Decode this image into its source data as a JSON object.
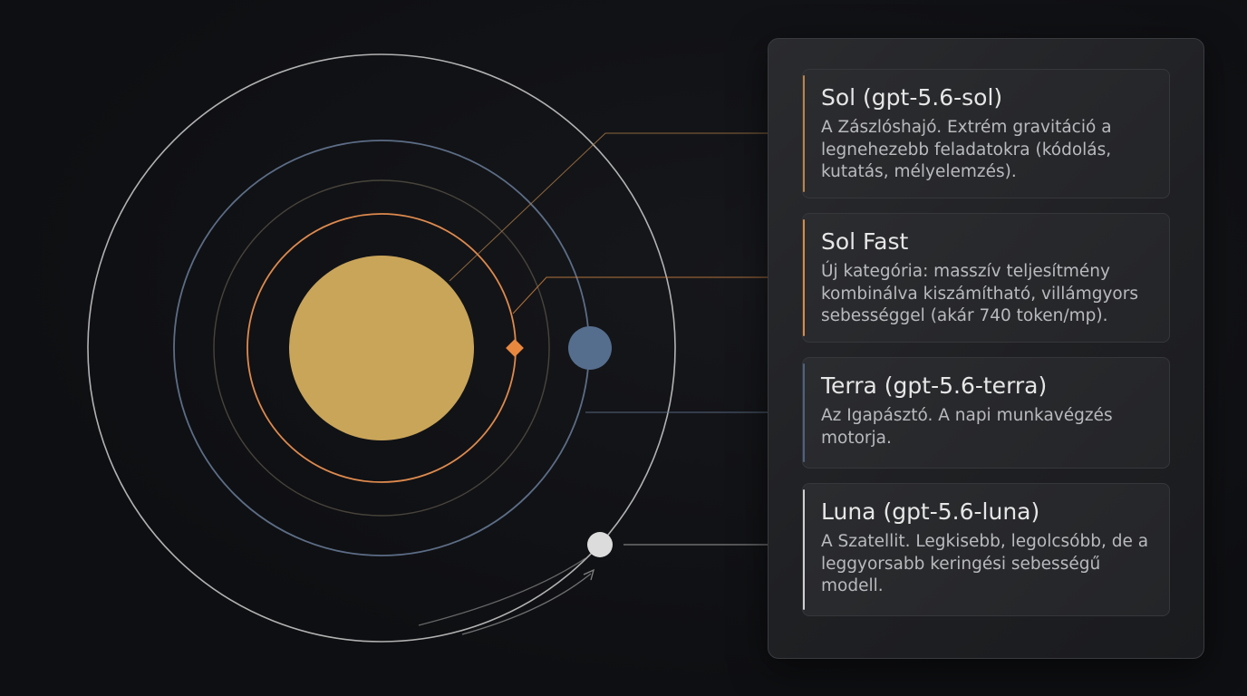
{
  "colors": {
    "sun": "#c9a55a",
    "sol_accent": "#c98a46",
    "sol_fast_accent": "#e08a44",
    "terra_accent": "#5a7090",
    "luna_accent": "#d8d8d8",
    "terra_orbit": "#5c6d86",
    "sol_fast_orbit": "#de8a4e",
    "outer_orbit": "#cfcfcf",
    "inner_faint_orbit": "#5a5348",
    "sol_fast_marker": "#e8883e",
    "terra_planet": "#566e8e",
    "luna_planet": "#dcdcdc"
  },
  "cards": [
    {
      "id": "sol",
      "title": "Sol (gpt-5.6-sol)",
      "description": "A Zászlóshajó. Extrém gravitáció a legnehezebb feladatokra (kódolás, kutatás, mélyelemzés).",
      "accent": "#b8844a"
    },
    {
      "id": "sol-fast",
      "title": "Sol Fast",
      "description": "Új kategória: masszív teljesítmény kombinálva kiszámítható, villámgyors sebességgel (akár 740 token/mp).",
      "accent": "#d98a44"
    },
    {
      "id": "terra",
      "title": "Terra (gpt-5.6-terra)",
      "description": "Az Igapásztó. A napi munkavégzés motorja.",
      "accent": "#4e6280"
    },
    {
      "id": "luna",
      "title": "Luna (gpt-5.6-luna)",
      "description": "A Szatellit. Legkisebb, legolcsóbb, de a leggyorsabb keringési sebességű modell.",
      "accent": "#cfcfcf"
    }
  ]
}
